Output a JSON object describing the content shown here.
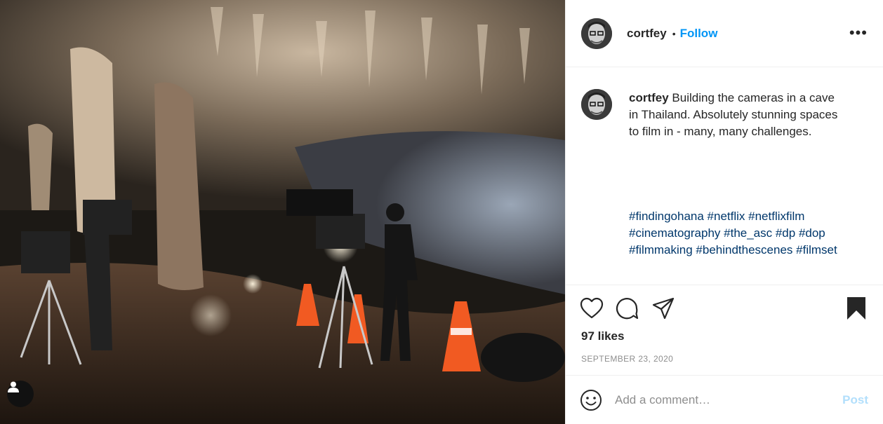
{
  "post": {
    "username": "cortfey",
    "follow_label": "Follow",
    "more_label": "•••",
    "caption_text": "Building the cameras in a cave in Thailand. Absolutely stunning spaces to film in - many, many challenges.",
    "hashtags": "#findingohana #netflix #netflixfilm #cinematography #the_asc #dp #dop #filmmaking #behindthescenes #filmset",
    "likes": "97 likes",
    "date": "SEPTEMBER 23, 2020"
  },
  "comment": {
    "placeholder": "Add a comment…",
    "post_label": "Post"
  },
  "icons": {
    "like": "heart-icon",
    "comment": "comment-icon",
    "share": "paper-plane-icon",
    "save": "bookmark-icon",
    "emoji": "smiley-icon",
    "tagged_user": "user-icon"
  },
  "colors": {
    "link_blue": "#0095f6",
    "hashtag_blue": "#00376b",
    "post_disabled": "#b2dffc",
    "secondary_text": "#8e8e8e"
  }
}
